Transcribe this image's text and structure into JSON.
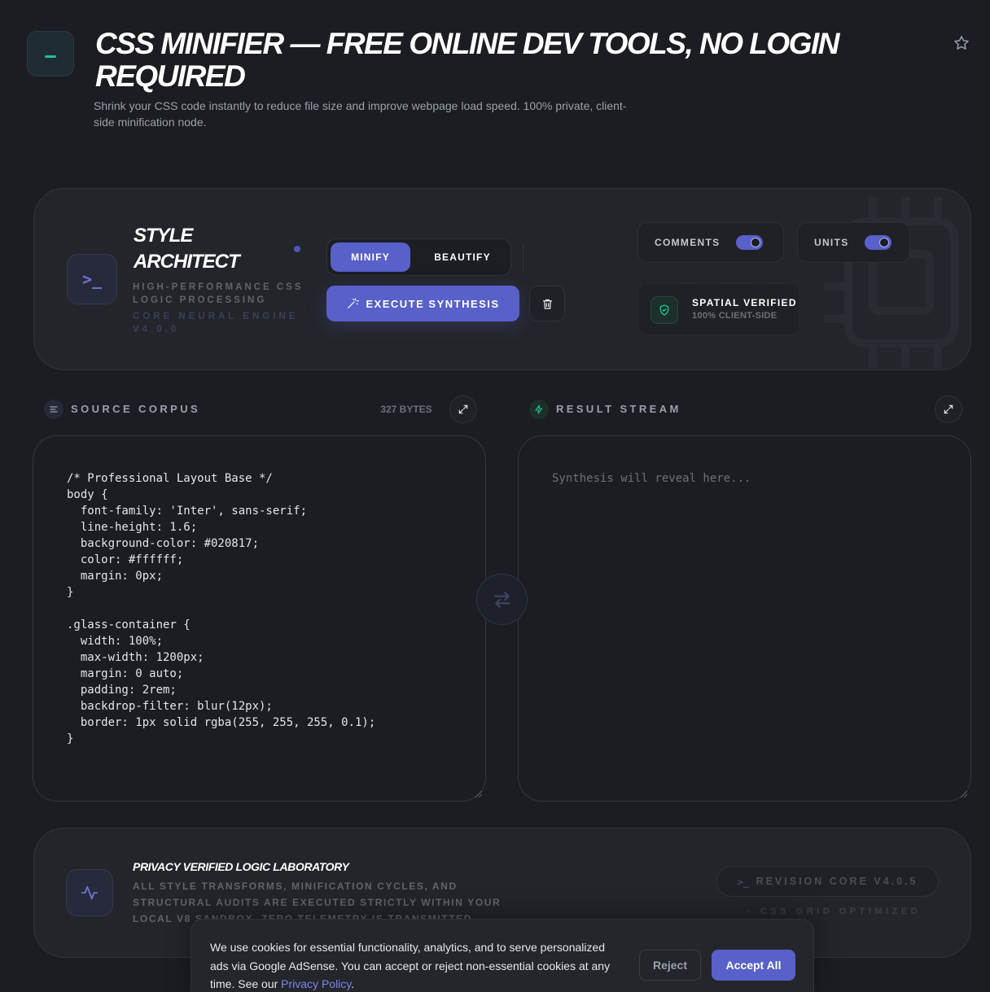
{
  "header": {
    "title": "CSS MINIFIER — FREE ONLINE DEV TOOLS, NO LOGIN REQUIRED",
    "subtitle": "Shrink your CSS code instantly to reduce file size and improve webpage load speed. 100% private, client-side minification node.",
    "logo_icon": "minus-icon",
    "favorite_icon": "star-icon"
  },
  "toolbar": {
    "brand_title": "STYLE ARCHITECT",
    "brand_subtitle": "HIGH-PERFORMANCE CSS LOGIC PROCESSING",
    "engine_label": "CORE NEURAL ENGINE V4.0.0",
    "modes": [
      "MINIFY",
      "BEAUTIFY"
    ],
    "active_mode": "MINIFY",
    "execute_label": "EXECUTE SYNTHESIS",
    "options": [
      {
        "label": "COMMENTS",
        "enabled": true
      },
      {
        "label": "UNITS",
        "enabled": true
      }
    ],
    "verified_title": "SPATIAL VERIFIED",
    "verified_sub": "100% CLIENT-SIDE"
  },
  "source": {
    "label": "SOURCE CORPUS",
    "bytes": "327 BYTES",
    "code": "/* Professional Layout Base */\nbody {\n  font-family: 'Inter', sans-serif;\n  line-height: 1.6;\n  background-color: #020817;\n  color: #ffffff;\n  margin: 0px;\n}\n\n.glass-container {\n  width: 100%;\n  max-width: 1200px;\n  margin: 0 auto;\n  padding: 2rem;\n  backdrop-filter: blur(12px);\n  border: 1px solid rgba(255, 255, 255, 0.1);\n}"
  },
  "result": {
    "label": "RESULT STREAM",
    "placeholder": "Synthesis will reveal here..."
  },
  "privacy": {
    "title": "PRIVACY VERIFIED LOGIC LABORATORY",
    "text": "ALL STYLE TRANSFORMS, MINIFICATION CYCLES, AND STRUCTURAL AUDITS ARE EXECUTED STRICTLY WITHIN YOUR LOCAL V8 SANDBOX. ZERO TELEMETRY IS TRANSMITTED.",
    "revision": "REVISION CORE V4.0.5",
    "grid": "CSS GRID OPTIMIZED"
  },
  "cookie": {
    "text": "We use cookies for essential functionality, analytics, and to serve personalized ads via Google AdSense. You can accept or reject non-essential cookies at any time. See our",
    "link": "Privacy Policy",
    "reject": "Reject",
    "accept": "Accept All"
  },
  "colors": {
    "accent": "#5860c9",
    "background": "#1b1d22",
    "success": "#22c29a"
  }
}
